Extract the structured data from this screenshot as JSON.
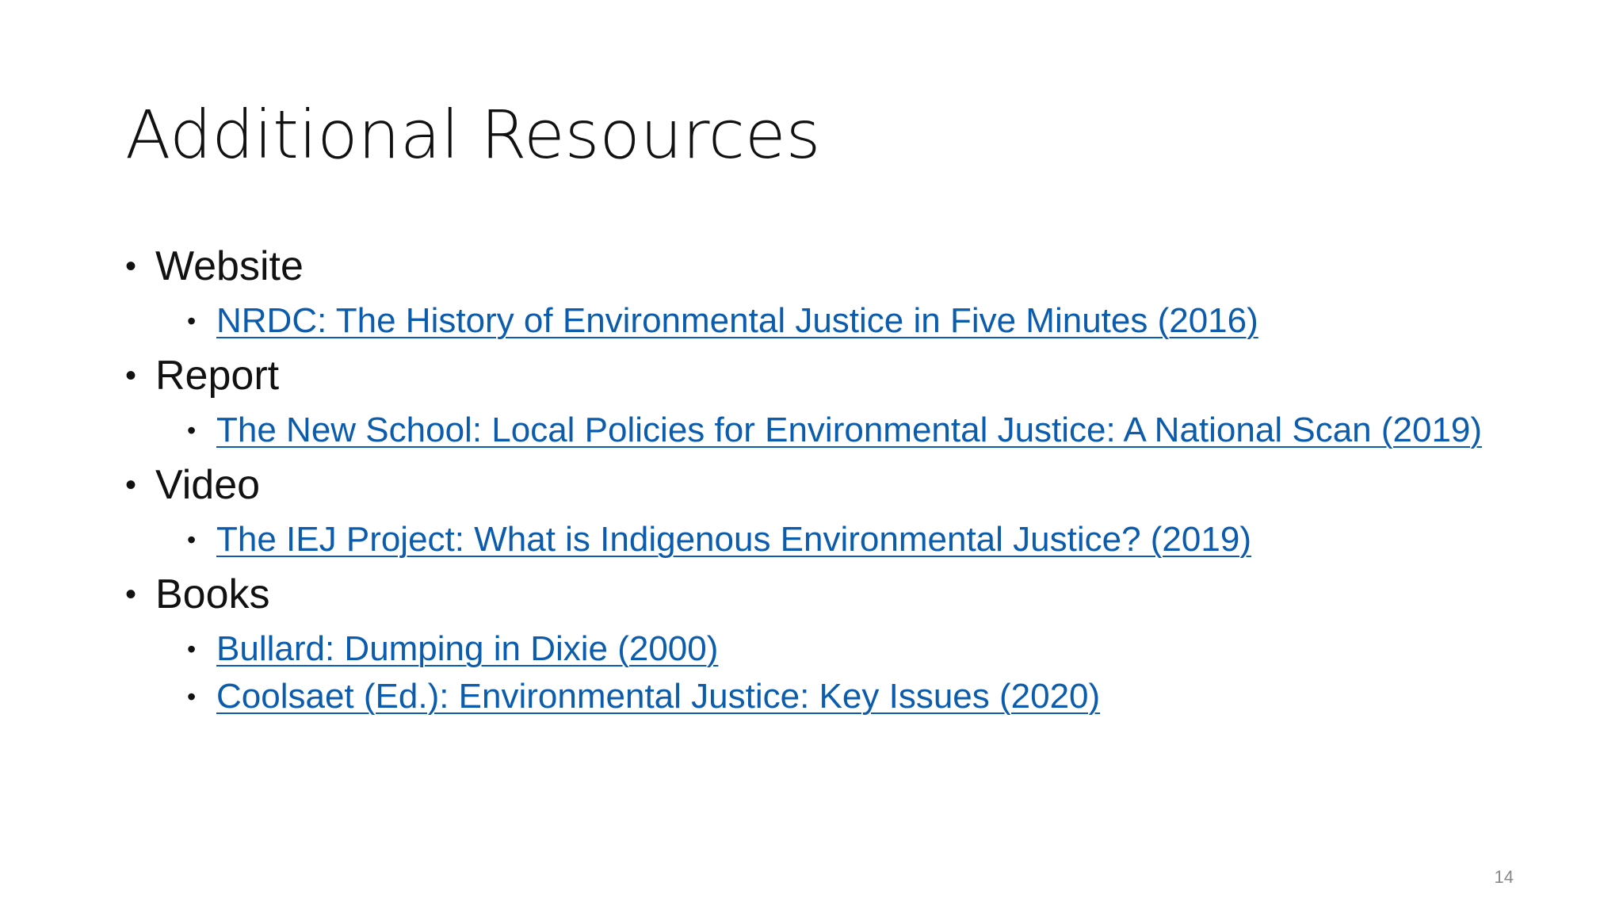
{
  "slide": {
    "title": "Additional Resources",
    "page_number": "14",
    "link_color": "#0b5cad",
    "sections": [
      {
        "heading": "Website",
        "links": [
          "NRDC: The History of Environmental Justice in Five Minutes (2016)"
        ]
      },
      {
        "heading": "Report",
        "links": [
          "The New School: Local Policies for Environmental Justice: A National Scan (2019)"
        ]
      },
      {
        "heading": "Video",
        "links": [
          "The IEJ Project: What is Indigenous Environmental Justice? (2019)"
        ]
      },
      {
        "heading": "Books",
        "links": [
          "Bullard: Dumping in Dixie (2000)",
          "Coolsaet (Ed.): Environmental Justice: Key Issues (2020)"
        ]
      }
    ]
  }
}
